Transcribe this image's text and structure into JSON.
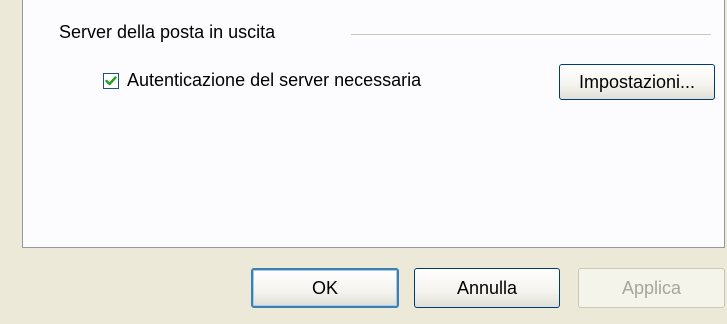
{
  "group": {
    "title": "Server della posta in uscita"
  },
  "auth_checkbox": {
    "label": "Autenticazione del server necessaria",
    "checked": true,
    "check_color": "#21a121"
  },
  "buttons": {
    "settings": "Impostazioni...",
    "ok": "OK",
    "cancel": "Annulla",
    "apply": "Applica"
  }
}
